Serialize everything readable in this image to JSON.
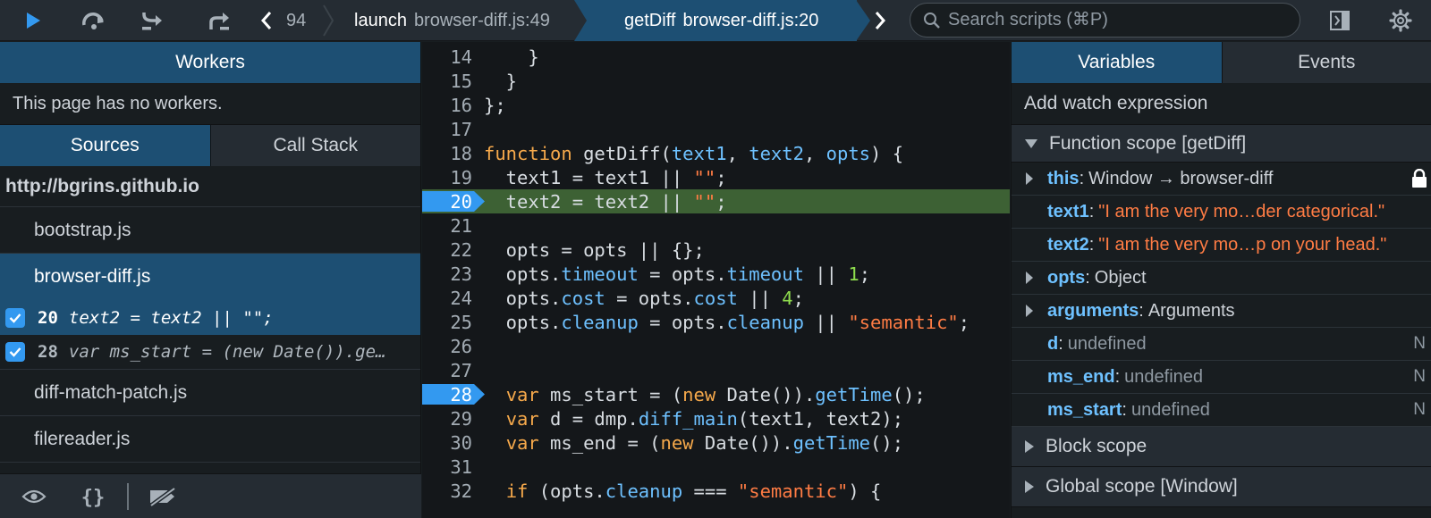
{
  "toolbar": {
    "buttons": [
      "resume-icon",
      "step-over-icon",
      "step-in-icon",
      "step-out-icon"
    ],
    "overflow_text": "94",
    "breadcrumbs": [
      {
        "fn": "launch",
        "loc": "browser-diff.js:49"
      },
      {
        "fn": "getDiff",
        "loc": "browser-diff.js:20"
      }
    ],
    "search_placeholder": "Search scripts (⌘P)"
  },
  "colors": {
    "selected": "#1d4f73",
    "current_line": "#3d6134",
    "breakpoint": "#3399f0",
    "keyword": "#f6a94b",
    "string": "#ff7c44",
    "param": "#6ec1ff",
    "number": "#8edc4d"
  },
  "left": {
    "workers_title": "Workers",
    "workers_empty": "This page has no workers.",
    "tabs": [
      "Sources",
      "Call Stack"
    ],
    "host": "http://bgrins.github.io",
    "sources": {
      "bootstrap": "bootstrap.js",
      "browser_diff": "browser-diff.js",
      "diff_match_patch": "diff-match-patch.js",
      "filereader": "filereader.js"
    },
    "breakpoints": [
      {
        "line": "20",
        "text": "text2 = text2 || \"\";"
      },
      {
        "line": "28",
        "text": "var ms_start = (new Date()).ge…"
      }
    ]
  },
  "editor": {
    "current_line": "20",
    "breakpoint_lines": [
      "20",
      "28"
    ],
    "lines": [
      {
        "n": "14",
        "code": "    }"
      },
      {
        "n": "15",
        "code": "  }"
      },
      {
        "n": "16",
        "code": "};"
      },
      {
        "n": "17",
        "code": ""
      },
      {
        "n": "18",
        "code": "function getDiff(text1, text2, opts) {"
      },
      {
        "n": "19",
        "code": "  text1 = text1 || \"\";"
      },
      {
        "n": "20",
        "code": "  text2 = text2 || \"\";"
      },
      {
        "n": "21",
        "code": ""
      },
      {
        "n": "22",
        "code": "  opts = opts || {};"
      },
      {
        "n": "23",
        "code": "  opts.timeout = opts.timeout || 1;"
      },
      {
        "n": "24",
        "code": "  opts.cost = opts.cost || 4;"
      },
      {
        "n": "25",
        "code": "  opts.cleanup = opts.cleanup || \"semantic\";"
      },
      {
        "n": "26",
        "code": ""
      },
      {
        "n": "27",
        "code": ""
      },
      {
        "n": "28",
        "code": "  var ms_start = (new Date()).getTime();"
      },
      {
        "n": "29",
        "code": "  var d = dmp.diff_main(text1, text2);"
      },
      {
        "n": "30",
        "code": "  var ms_end = (new Date()).getTime();"
      },
      {
        "n": "31",
        "code": ""
      },
      {
        "n": "32",
        "code": "  if (opts.cleanup === \"semantic\") {"
      }
    ]
  },
  "right": {
    "tabs": [
      "Variables",
      "Events"
    ],
    "watch": "Add watch expression",
    "function_scope": "Function scope [getDiff]",
    "vars": [
      {
        "name": "this",
        "value": "Window → browser-diff",
        "kind": "obj",
        "expand": true,
        "lock": true
      },
      {
        "name": "text1",
        "value": "\"I am the very mo…der categorical.\"",
        "kind": "str",
        "expand": false
      },
      {
        "name": "text2",
        "value": "\"I am the very mo…p on your head.\"",
        "kind": "str",
        "expand": false
      },
      {
        "name": "opts",
        "value": "Object",
        "kind": "obj",
        "expand": true
      },
      {
        "name": "arguments",
        "value": "Arguments",
        "kind": "obj",
        "expand": true
      },
      {
        "name": "d",
        "value": "undefined",
        "kind": "undef",
        "expand": false,
        "tag": "N"
      },
      {
        "name": "ms_end",
        "value": "undefined",
        "kind": "undef",
        "expand": false,
        "tag": "N"
      },
      {
        "name": "ms_start",
        "value": "undefined",
        "kind": "undef",
        "expand": false,
        "tag": "N"
      }
    ],
    "block_scope": "Block scope",
    "global_scope": "Global scope [Window]"
  }
}
